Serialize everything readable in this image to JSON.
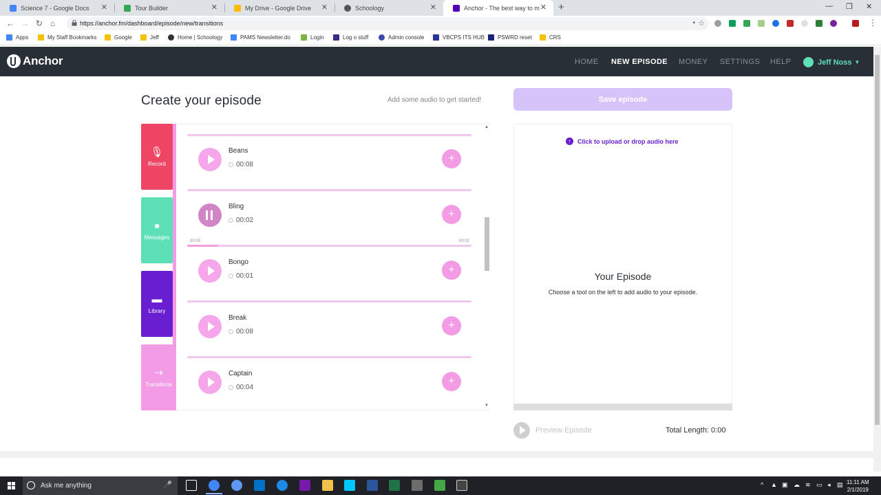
{
  "browser": {
    "tabs": [
      {
        "title": "Science 7 - Google Docs",
        "color": "#4285f4"
      },
      {
        "title": "Tour Builder",
        "color": "#34a853"
      },
      {
        "title": "My Drive - Google Drive",
        "color": "#fbbc04"
      },
      {
        "title": "Schoology",
        "color": "#555555"
      },
      {
        "title": "Anchor - The best way to m",
        "color": "#5000b9"
      }
    ],
    "url": "https://anchor.fm/dashboard/episode/new/transitions",
    "bookmarks": [
      {
        "label": "Apps"
      },
      {
        "label": "My Staff Bookmarks"
      },
      {
        "label": "Google"
      },
      {
        "label": "Jeff"
      },
      {
        "label": "Home | Schoology"
      },
      {
        "label": "PAMS Newsletter.do"
      },
      {
        "label": "Login"
      },
      {
        "label": "Log o stuff"
      },
      {
        "label": "Admin console"
      },
      {
        "label": "VBCPS ITS HUB"
      },
      {
        "label": "PSWRD reset"
      },
      {
        "label": "CRS"
      }
    ]
  },
  "anchor": {
    "logo": "Anchor",
    "nav": [
      "HOME",
      "NEW EPISODE",
      "MONEY",
      "SETTINGS",
      "HELP"
    ],
    "active_nav": "NEW EPISODE",
    "user_name": "Jeff Noss"
  },
  "main": {
    "title": "Create your episode",
    "hint": "Add some audio to get started!",
    "save_label": "Save episode",
    "tools": [
      {
        "label": "Record",
        "color": "#ef4565"
      },
      {
        "label": "Messages",
        "color": "#5ee0b6"
      },
      {
        "label": "Library",
        "color": "#6a1ed1"
      },
      {
        "label": "Transitions",
        "color": "#f49be6"
      }
    ],
    "transitions": [
      {
        "name": "Beans",
        "duration": "00:08"
      },
      {
        "name": "Bling",
        "duration": "00:02",
        "playing": true,
        "elapsed": "00:00",
        "length": "00:02",
        "progress": 0.11
      },
      {
        "name": "Bongo",
        "duration": "00:01"
      },
      {
        "name": "Break",
        "duration": "00:08"
      },
      {
        "name": "Captain",
        "duration": "00:04"
      }
    ]
  },
  "episode": {
    "upload_label": "Click to upload or drop audio here",
    "title": "Your Episode",
    "subtitle": "Choose a tool on the left to add audio to your episode.",
    "preview_label": "Preview Episode",
    "total_length": "Total Length: 0:00"
  },
  "taskbar": {
    "search_placeholder": "Ask me anything",
    "time": "11:11 AM",
    "date": "2/1/2019"
  }
}
